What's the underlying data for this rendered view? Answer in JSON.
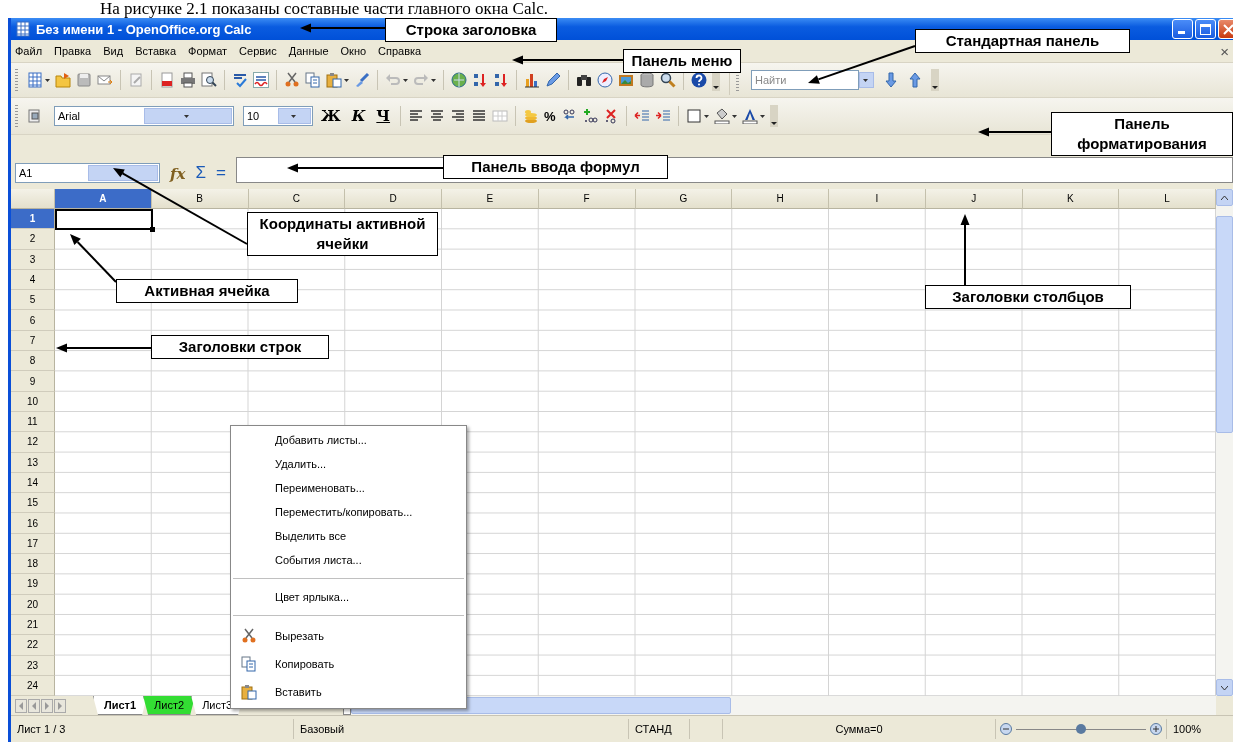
{
  "caption": "На рисунке 2.1 показаны составные части главного окна Calc.",
  "window": {
    "title": "Без имени 1 - OpenOffice.org Calc"
  },
  "menu": {
    "items": [
      "Файл",
      "Правка",
      "Вид",
      "Вставка",
      "Формат",
      "Сервис",
      "Данные",
      "Окно",
      "Справка"
    ],
    "close_glyph": "×"
  },
  "find_toolbar": {
    "placeholder": "Найти"
  },
  "format_toolbar": {
    "font": "Arial",
    "size": "10",
    "style_buttons": [
      "Ж",
      "К",
      "Ч"
    ],
    "percent": "%"
  },
  "formula_bar": {
    "cell_reference": "A1",
    "wizard": "fx",
    "buttons": [
      "Σ",
      "="
    ]
  },
  "columns": [
    {
      "label": "A",
      "selected": true
    },
    {
      "label": "B",
      "selected": false
    },
    {
      "label": "C",
      "selected": false
    },
    {
      "label": "D",
      "selected": false
    },
    {
      "label": "E",
      "selected": false
    },
    {
      "label": "F",
      "selected": false
    },
    {
      "label": "G",
      "selected": false
    },
    {
      "label": "H",
      "selected": false
    },
    {
      "label": "I",
      "selected": false
    },
    {
      "label": "J",
      "selected": false
    },
    {
      "label": "K",
      "selected": false
    },
    {
      "label": "L",
      "selected": false
    }
  ],
  "rows": [
    {
      "label": "1",
      "selected": true
    },
    {
      "label": "2",
      "selected": false
    },
    {
      "label": "3",
      "selected": false
    },
    {
      "label": "4",
      "selected": false
    },
    {
      "label": "5",
      "selected": false
    },
    {
      "label": "6",
      "selected": false
    },
    {
      "label": "7",
      "selected": false
    },
    {
      "label": "8",
      "selected": false
    },
    {
      "label": "9",
      "selected": false
    },
    {
      "label": "10",
      "selected": false
    },
    {
      "label": "11",
      "selected": false
    },
    {
      "label": "12",
      "selected": false
    },
    {
      "label": "13",
      "selected": false
    },
    {
      "label": "14",
      "selected": false
    },
    {
      "label": "15",
      "selected": false
    },
    {
      "label": "16",
      "selected": false
    },
    {
      "label": "17",
      "selected": false
    },
    {
      "label": "18",
      "selected": false
    },
    {
      "label": "19",
      "selected": false
    },
    {
      "label": "20",
      "selected": false
    },
    {
      "label": "21",
      "selected": false
    },
    {
      "label": "22",
      "selected": false
    },
    {
      "label": "23",
      "selected": false
    },
    {
      "label": "24",
      "selected": false
    }
  ],
  "context_menu": {
    "items": [
      {
        "kind": "item",
        "label": "Добавить листы..."
      },
      {
        "kind": "item",
        "label": "Удалить..."
      },
      {
        "kind": "item",
        "label": "Переименовать..."
      },
      {
        "kind": "item",
        "label": "Переместить/копировать..."
      },
      {
        "kind": "item",
        "label": "Выделить все"
      },
      {
        "kind": "item",
        "label": "События листа..."
      },
      {
        "kind": "separator"
      },
      {
        "kind": "item",
        "label": "Цвет ярлыка..."
      },
      {
        "kind": "separator"
      },
      {
        "kind": "icon_item",
        "label": "Вырезать"
      },
      {
        "kind": "icon_item",
        "label": "Копировать"
      },
      {
        "kind": "icon_item",
        "label": "Вставить"
      }
    ]
  },
  "sheet_tabs": [
    {
      "label": "Лист1",
      "selected": true
    },
    {
      "label": "Лист2",
      "selected": false,
      "color": "#33dd33"
    },
    {
      "label": "Лист3",
      "selected": false
    }
  ],
  "status_bar": {
    "sheet": "Лист 1 / 3",
    "style": "Базовый",
    "mode": "СТАНД",
    "sum": "Сумма=0",
    "zoom": {
      "level": 0.5
    },
    "zoom_text": "100%"
  },
  "callouts": [
    "Строка заголовка",
    "Панель меню",
    "Стандартная панель",
    "Панель форматирования",
    "Панель ввода формул",
    "Координаты активной ячейки",
    "Активная ячейка",
    "Заголовки строк",
    "Заголовки столбцов"
  ]
}
